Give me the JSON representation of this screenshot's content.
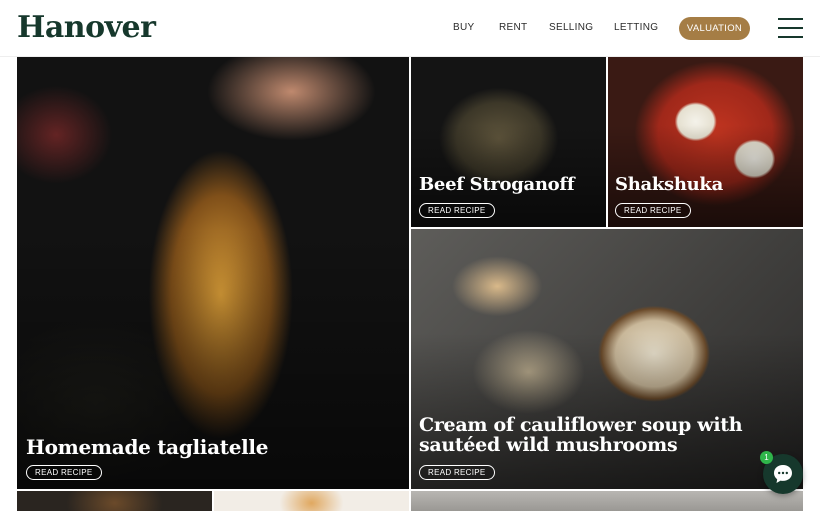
{
  "header": {
    "logo": "Hanover",
    "nav": [
      {
        "label": "BUY"
      },
      {
        "label": "RENT"
      },
      {
        "label": "SELLING"
      },
      {
        "label": "LETTING"
      }
    ],
    "valuation_label": "VALUATION",
    "menu_icon": "hamburger-menu-icon"
  },
  "recipes": [
    {
      "title": "Homemade tagliatelle",
      "button": "READ RECIPE"
    },
    {
      "title": "Beef Stroganoff",
      "button": "READ RECIPE"
    },
    {
      "title": "Shakshuka",
      "button": "READ RECIPE"
    },
    {
      "title": "Cream of cauliflower soup with sautéed wild mushrooms",
      "button": "READ RECIPE"
    }
  ],
  "chat": {
    "icon": "chat-bubble-icon",
    "badge": "1"
  },
  "colors": {
    "brand_green": "#16382c",
    "accent_gold": "#a57d45",
    "badge_green": "#2fb54a"
  }
}
